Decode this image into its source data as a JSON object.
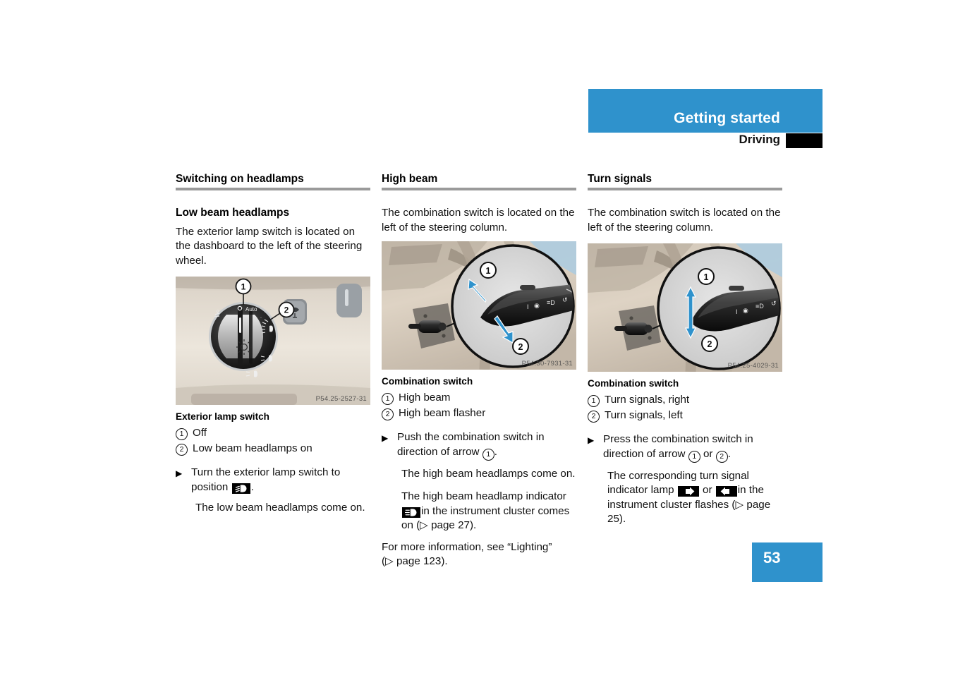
{
  "header": {
    "title": "Getting started",
    "subtitle": "Driving",
    "tab_mark": ""
  },
  "page_number": "53",
  "columns": {
    "left": {
      "section_heading": "Switching on headlamps",
      "sub_heading": "Low beam headlamps",
      "intro": "The exterior lamp switch is located on the dashboard to the left of the steering wheel.",
      "figure": {
        "code": "P54.25-2527-31",
        "alt": "Exterior lamp rotary switch on dashboard with callouts 1 and 2"
      },
      "caption_heading": "Exterior lamp switch",
      "legend": [
        {
          "num": "1",
          "text": "Off"
        },
        {
          "num": "2",
          "text": "Low beam headlamps on"
        }
      ],
      "step_1_part_a": "Turn the exterior lamp switch to position",
      "step_1_part_b": ".",
      "step_1_icon": "low-beam-icon",
      "step_1_result": "The low beam headlamps come on."
    },
    "middle": {
      "section_heading": "High beam",
      "intro": "The combination switch is located on the left of the steering column.",
      "figure": {
        "code": "P54.30-7931-31",
        "alt": "Combination switch on steering column with arrows 1 and 2"
      },
      "caption_heading": "Combination switch",
      "legend": [
        {
          "num": "1",
          "text": "High beam"
        },
        {
          "num": "2",
          "text": "High beam flasher"
        }
      ],
      "step_1_part_a": "Push the combination switch in direction of arrow",
      "step_1_arrow_num": "1",
      "step_1_part_b": ".",
      "step_1_result": "The high beam headlamps come on.",
      "step_2_part_a": "The high beam headlamp indicator",
      "step_2_icon": "high-beam-icon",
      "step_2_part_b": "in the instrument cluster comes on (",
      "step_2_page_ref": "page 27",
      "step_2_part_c": ").",
      "note_part_a": "For more information, see “Lighting” (",
      "note_page_ref": "page 123",
      "note_part_b": ")."
    },
    "right": {
      "section_heading": "Turn signals",
      "intro": "The combination switch is located on the left of the steering column.",
      "figure": {
        "code": "P54.25-4029-31",
        "alt": "Combination switch on steering column with up/down arrows 1 and 2"
      },
      "caption_heading": "Combination switch",
      "legend": [
        {
          "num": "1",
          "text": "Turn signals, right"
        },
        {
          "num": "2",
          "text": "Turn signals, left"
        }
      ],
      "step_1_part_a": "Press the combination switch in direction of arrow",
      "step_1_arrow_num_a": "1",
      "step_1_or": "or",
      "step_1_arrow_num_b": "2",
      "step_1_part_b": ".",
      "step_1_result_a": "The corresponding turn signal indicator lamp",
      "step_1_icon_right": "turn-signal-right-icon",
      "step_1_result_or": "or",
      "step_1_icon_left": "turn-signal-left-icon",
      "step_1_result_b": "in the instrument cluster flashes (",
      "step_1_page_ref": "page 25",
      "step_1_result_c": ")."
    }
  },
  "colors": {
    "accent_blue": "#2f92cc",
    "rule_gray": "#9a9a9a",
    "text_black": "#111111"
  }
}
